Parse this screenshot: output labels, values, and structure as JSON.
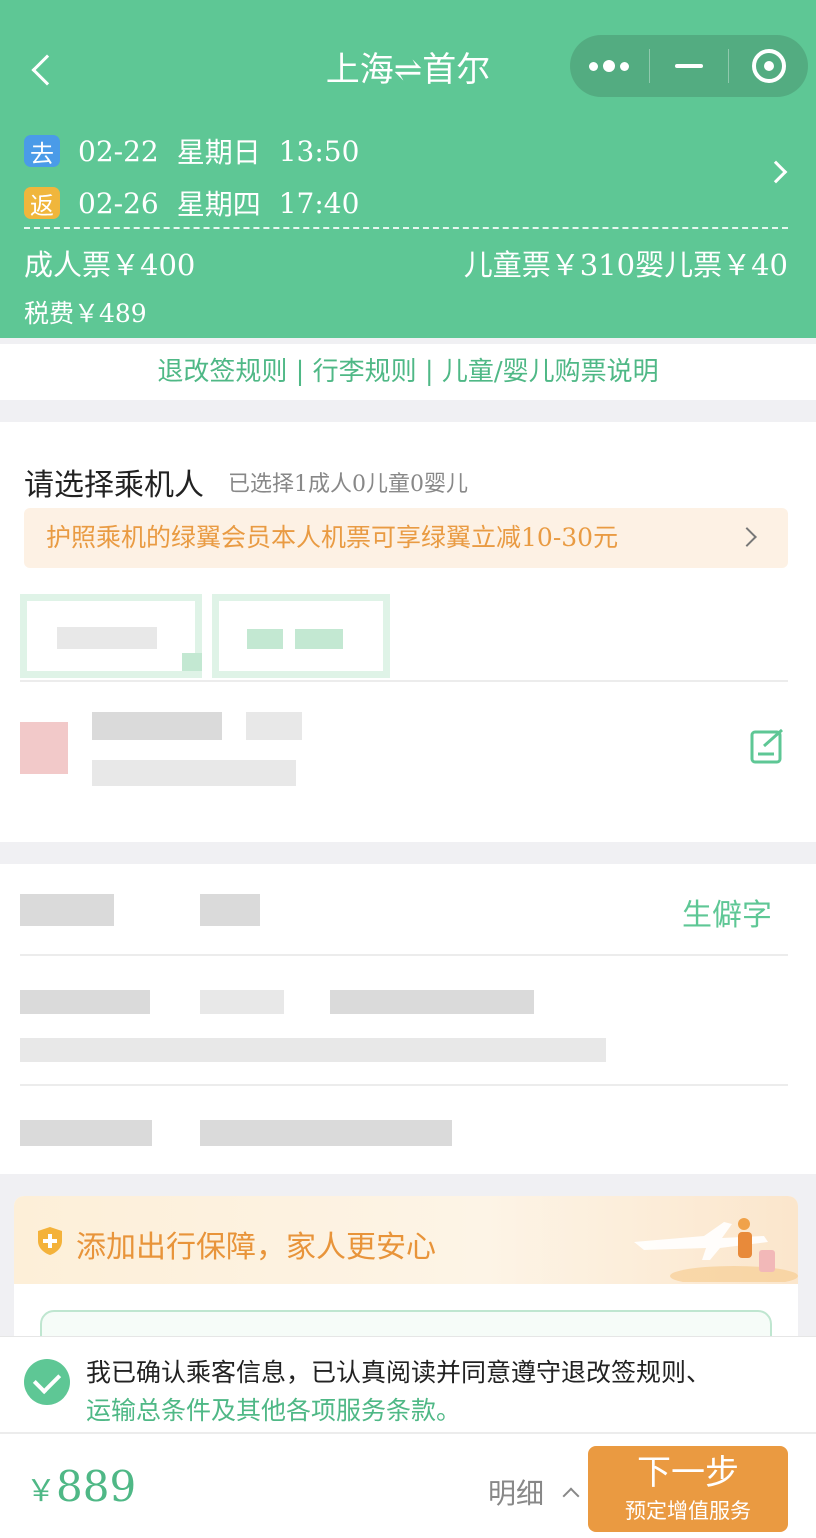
{
  "header": {
    "title": "上海⇌首尔",
    "outbound": {
      "tag": "去",
      "date": "02-22",
      "weekday": "星期日",
      "time": "13:50"
    },
    "return": {
      "tag": "返",
      "date": "02-26",
      "weekday": "星期四",
      "time": "17:40"
    },
    "adult_price": "成人票￥400",
    "child_infant_price": "儿童票￥310婴儿票￥40",
    "tax": "税费￥489",
    "colors": {
      "primary": "#5ec795",
      "go_tag": "#4a9be8",
      "back_tag": "#f0b63c"
    }
  },
  "rules": {
    "text": "退改签规则 | 行李规则 | 儿童/婴儿购票说明"
  },
  "passengers": {
    "title": "请选择乘机人",
    "selected": "已选择1成人0儿童0婴儿",
    "promo": "护照乘机的绿翼会员本人机票可享绿翼立减10-30元",
    "rare_char_label": "生僻字"
  },
  "insurance": {
    "title": "添加出行保障，家人更安心"
  },
  "confirm": {
    "line1": "我已确认乘客信息，已认真阅读并同意遵守退改签规则、",
    "line2": "运输总条件及其他各项服务条款。"
  },
  "bottom": {
    "currency": "￥",
    "total": "889",
    "detail": "明细",
    "next_label": "下一步",
    "next_sub": "预定增值服务",
    "accent": "#ea9a41"
  }
}
